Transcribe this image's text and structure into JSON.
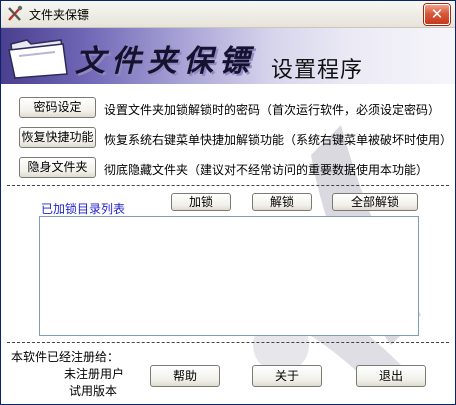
{
  "window": {
    "title": "文件夹保镖"
  },
  "banner": {
    "logo_text": "文件夹保镖",
    "subtitle": "设置程序"
  },
  "actions": [
    {
      "button": "密码设定",
      "description": "设置文件夹加锁解锁时的密码（首次运行软件，必须设定密码）"
    },
    {
      "button": "恢复快捷功能",
      "description": "恢复系统右键菜单快捷加解锁功能（系统右键菜单被破坏时使用）"
    },
    {
      "button": "隐身文件夹",
      "description": "彻底隐藏文件夹（建议对不经常访问的重要数据使用本功能）"
    }
  ],
  "list": {
    "label": "已加锁目录列表",
    "lock_button": "加锁",
    "unlock_button": "解锁",
    "unlock_all_button": "全部解锁",
    "items": []
  },
  "registration": {
    "heading": "本软件已经注册给：",
    "user": "未注册用户",
    "edition": "试用版本"
  },
  "footer": {
    "help_button": "帮助",
    "about_button": "关于",
    "exit_button": "退出"
  }
}
